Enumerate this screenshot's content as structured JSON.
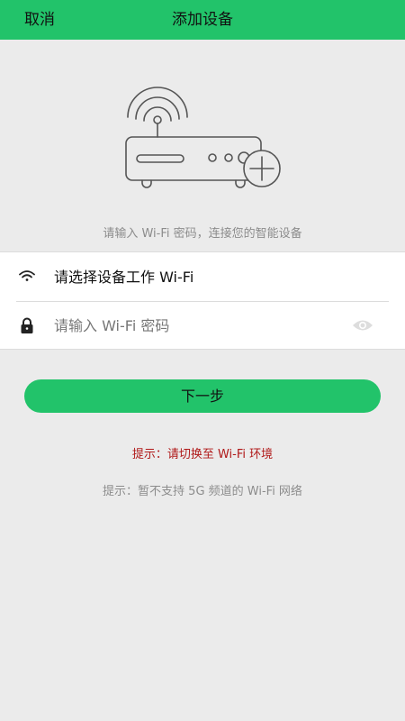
{
  "header": {
    "cancel_label": "取消",
    "title": "添加设备"
  },
  "hint_top": "请输入 Wi-Fi 密码，连接您的智能设备",
  "form": {
    "wifi_label": "请选择设备工作 Wi-Fi",
    "password_placeholder": "请输入 Wi-Fi 密码",
    "password_value": ""
  },
  "next_button_label": "下一步",
  "tips": {
    "switch_wifi": "提示：请切换至 Wi-Fi 环境",
    "no_5g": "提示：暂不支持 5G 频道的 Wi-Fi 网络"
  },
  "colors": {
    "accent": "#22c36a",
    "warning_text": "#b01818",
    "muted_text": "#8c8c8c",
    "background": "#ebebeb"
  },
  "icons": {
    "illustration": "router-add-icon",
    "wifi": "wifi-icon",
    "lock": "lock-icon",
    "eye": "eye-icon"
  }
}
